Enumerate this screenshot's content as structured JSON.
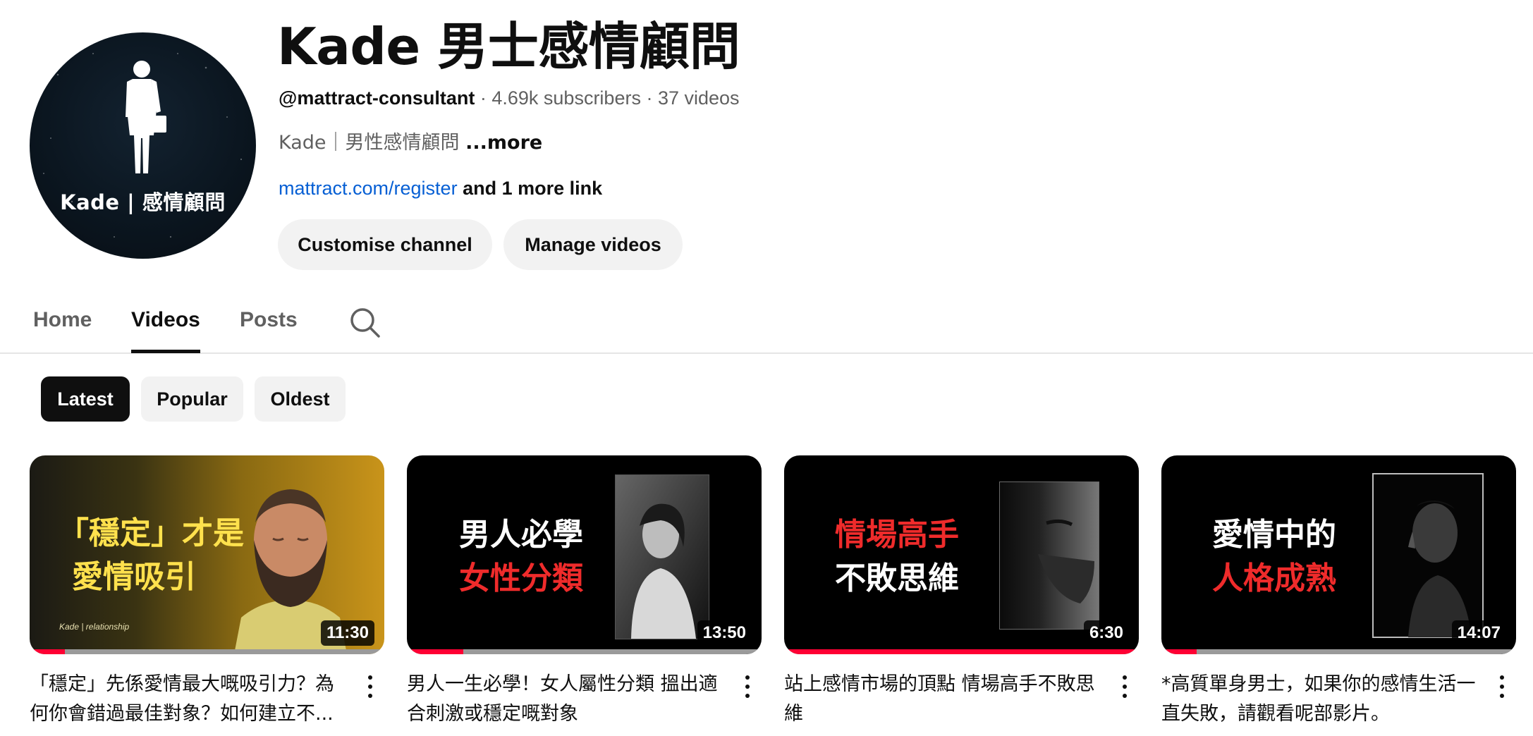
{
  "channel": {
    "avatar_label": "Kade | 感情顧問",
    "title": "Kade 男士感情顧問",
    "handle": "@mattract-consultant",
    "subscribers": "4.69k subscribers",
    "videos_count": "37 videos",
    "separator": " · ",
    "description": "Kade｜男性感情顧問 ",
    "description_more": "...more",
    "link_url": "mattract.com/register",
    "link_more": " and 1 more link"
  },
  "actions": {
    "customise_label": "Customise channel",
    "manage_label": "Manage videos"
  },
  "tabs": [
    {
      "label": "Home"
    },
    {
      "label": "Videos"
    },
    {
      "label": "Posts"
    }
  ],
  "active_tab": "Videos",
  "filters": [
    {
      "label": "Latest"
    },
    {
      "label": "Popular"
    },
    {
      "label": "Oldest"
    }
  ],
  "selected_filter": "Latest",
  "videos": [
    {
      "thumb_line1": "「穩定」才是",
      "thumb_line2": "愛情吸引",
      "thumb_small": "Kade | relationship",
      "duration": "11:30",
      "progress": 0.1,
      "title": "「穩定」先係愛情最大嘅吸引力？為何你會錯過最佳對象？如何建立不..."
    },
    {
      "thumb_line1": "男人必學",
      "thumb_line2": "女性分類",
      "duration": "13:50",
      "progress": 0.16,
      "title": "男人一生必學！女人屬性分類 搵出適合刺激或穩定嘅對象"
    },
    {
      "thumb_line1": "情場高手",
      "thumb_line2": "不敗思維",
      "duration": "6:30",
      "progress": 1.0,
      "title": "站上感情市場的頂點 情場高手不敗思維"
    },
    {
      "thumb_line1": "愛情中的",
      "thumb_line2": "人格成熟",
      "duration": "14:07",
      "progress": 0.1,
      "title": "*高質單身男士，如果你的感情生活一直失敗，請觀看呢部影片。"
    }
  ],
  "colors": {
    "accent_red": "#ff0033",
    "link_blue": "#065fd4",
    "thumb_red_text": "#ef2b2b",
    "thumb_yellow_text": "#ffe14d"
  }
}
